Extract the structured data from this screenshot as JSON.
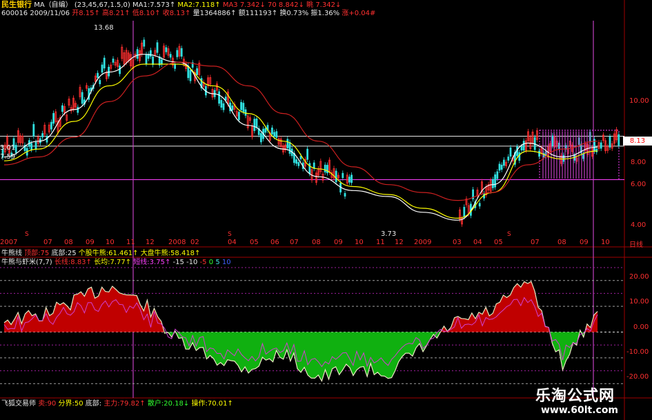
{
  "header": {
    "stock_name": "民生银行",
    "ma_label": "MA（自编）",
    "ma_params": "(23,45,67,1.5,0)",
    "ma1": "MA1:7.573↑",
    "ma2": "MA2:7.118↑",
    "ma3": "MA3 7.342↓",
    "ma_extra1": "70 8.842↓",
    "ma_extra2": "眺 7.342↓"
  },
  "quote_line": {
    "code": "600016",
    "date": "2009/11/06",
    "open": "开8.15↑",
    "high": "高8.21↑",
    "low": "低8.10↑",
    "close": "收8.13↑",
    "volume": "量1364886↑",
    "amount": "额111193↑",
    "turnover": "换0.73%",
    "amplitude": "振1.36%",
    "change": "涨+0.04#"
  },
  "price_annotations": {
    "peak": "13.68",
    "trough": "3.73",
    "left_1": "3.01",
    "left_2": "7.59",
    "current_price": "8.13"
  },
  "price_axis": [
    "10.00",
    "8.00",
    "6.00",
    "4.00"
  ],
  "time_axis": {
    "labels": [
      "2007",
      "07",
      "08",
      "09",
      "10",
      "11",
      "12",
      "2008",
      "02",
      "04",
      "05",
      "06",
      "07",
      "08",
      "09",
      "10",
      "11",
      "12",
      "2009",
      "03",
      "04",
      "05",
      "07",
      "08",
      "09",
      "10"
    ],
    "period": "日线"
  },
  "indicator_titles": {
    "title1": "牛熊线",
    "top": "顶部:75",
    "bottom": "底部:25",
    "stock_bull": "个股牛熊:61.461↑",
    "market_bull": "大盘牛熊:58.418↑",
    "title2": "牛熊与虾米(7,7)",
    "long": "长线:8.83↑",
    "long_avg": "长均:7.77↑",
    "short": "短线:3.75↑",
    "levels": [
      "-15",
      "-10",
      "-5",
      "0",
      "5",
      "10"
    ]
  },
  "osc_axis": [
    "20.00",
    "10.00",
    "0.00",
    "-10.00",
    "-20.00"
  ],
  "bottom_bar": {
    "name": "飞狐交易师",
    "v1": "卖:90",
    "boundary": "分界:50",
    "bottom": "底部:",
    "main": "主力:79.82↑",
    "retail": "散户:20.18↓",
    "op": "操作:70.01↑"
  },
  "watermark": {
    "title": "乐淘公式网",
    "url": "www.60lt.com"
  },
  "chart_data": [
    {
      "type": "line",
      "title": "",
      "series": [
        {
          "name": "MA1",
          "color": "#ffffff",
          "x": [
            "2007-01",
            "2007-03",
            "2007-05",
            "2007-07",
            "2007-09",
            "2007-11",
            "2008-01",
            "2008-03",
            "2008-05",
            "2008-07",
            "2008-09",
            "2008-11",
            "2009-01",
            "2009-03",
            "2009-05",
            "2009-07",
            "2009-09",
            "2009-11"
          ],
          "values": [
            7.6,
            8.4,
            10.0,
            11.9,
            12.8,
            12.4,
            10.8,
            9.2,
            8.0,
            6.6,
            5.9,
            5.6,
            4.8,
            4.4,
            6.2,
            8.3,
            7.6,
            8.1
          ]
        },
        {
          "name": "MA2",
          "color": "#ffff00",
          "x": [
            "2007-01",
            "2007-03",
            "2007-05",
            "2007-07",
            "2007-09",
            "2007-11",
            "2008-01",
            "2008-03",
            "2008-05",
            "2008-07",
            "2008-09",
            "2008-11",
            "2009-01",
            "2009-03",
            "2009-05",
            "2009-07",
            "2009-09",
            "2009-11"
          ],
          "values": [
            7.4,
            8.0,
            9.4,
            11.2,
            12.3,
            12.3,
            11.2,
            9.8,
            8.4,
            7.0,
            6.1,
            5.7,
            5.0,
            4.5,
            5.8,
            7.9,
            7.5,
            7.9
          ]
        },
        {
          "name": "MA3",
          "color": "#cc2020",
          "x": [
            "2007-01",
            "2007-03",
            "2007-05",
            "2007-07",
            "2007-09",
            "2007-11",
            "2008-01",
            "2008-03",
            "2008-05",
            "2008-07",
            "2008-09",
            "2008-11",
            "2009-01",
            "2009-03",
            "2009-05",
            "2009-07",
            "2009-09",
            "2009-11"
          ],
          "values": [
            7.2,
            7.6,
            8.6,
            10.4,
            11.7,
            12.4,
            12.2,
            11.2,
            9.8,
            8.4,
            7.1,
            6.2,
            5.8,
            5.4,
            5.8,
            7.2,
            8.0,
            8.4
          ]
        }
      ],
      "ylim": [
        3.5,
        14.5
      ]
    },
    {
      "type": "area",
      "title": "",
      "series": [
        {
          "name": "长线",
          "color": "#e8e8c0",
          "x": [
            "2007-01",
            "2007-03",
            "2007-05",
            "2007-07",
            "2007-09",
            "2007-11",
            "2008-01",
            "2008-03",
            "2008-05",
            "2008-07",
            "2008-09",
            "2008-11",
            "2009-01",
            "2009-03",
            "2009-05",
            "2009-07",
            "2009-09",
            "2009-11"
          ],
          "values": [
            5,
            6,
            12,
            18,
            11,
            -4,
            -10,
            -14,
            -8,
            -18,
            -14,
            -16,
            -6,
            4,
            8,
            20,
            -12,
            8
          ]
        }
      ],
      "ylim": [
        -25,
        25
      ]
    }
  ]
}
